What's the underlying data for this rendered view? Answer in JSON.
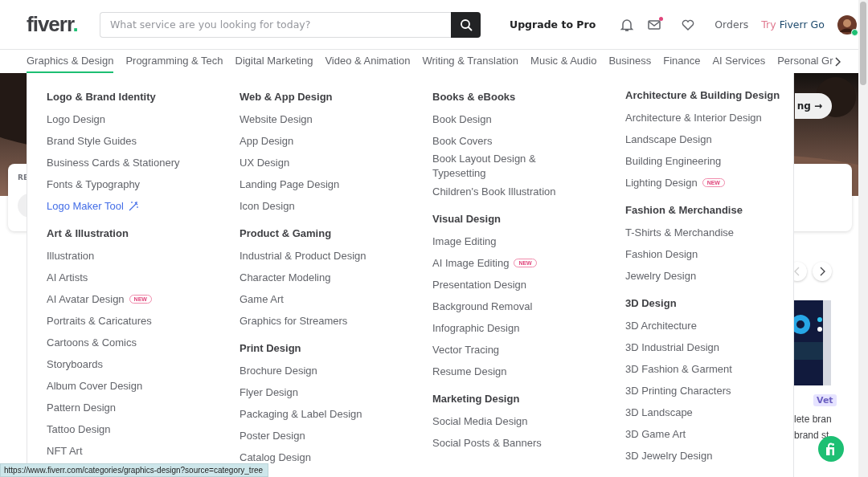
{
  "header": {
    "logo": "fiverr",
    "logo_dot": ".",
    "search": {
      "placeholder": "What service are you looking for today?"
    },
    "upgrade": "Upgrade to Pro",
    "messages_unread": true,
    "orders": "Orders",
    "try_prefix": "Try ",
    "try_brand": "Fiverr Go",
    "online": true
  },
  "categories": [
    {
      "label": "Graphics & Design",
      "selected": true
    },
    {
      "label": "Programming & Tech",
      "selected": false
    },
    {
      "label": "Digital Marketing",
      "selected": false
    },
    {
      "label": "Video & Animation",
      "selected": false
    },
    {
      "label": "Writing & Translation",
      "selected": false
    },
    {
      "label": "Music & Audio",
      "selected": false
    },
    {
      "label": "Business",
      "selected": false
    },
    {
      "label": "Finance",
      "selected": false
    },
    {
      "label": "AI Services",
      "selected": false
    },
    {
      "label": "Personal Gr",
      "selected": false
    }
  ],
  "background": {
    "card_label": "RE",
    "hero_button": "ng →",
    "tag": "Vet",
    "gig_lines": [
      "lete bran",
      "brand st"
    ]
  },
  "menu": {
    "columns": [
      [
        {
          "title": "Logo & Brand Identity",
          "items": [
            {
              "label": "Logo Design",
              "kind": "plain"
            },
            {
              "label": "Brand Style Guides",
              "kind": "plain"
            },
            {
              "label": "Business Cards & Stationery",
              "kind": "plain"
            },
            {
              "label": "Fonts & Typography",
              "kind": "plain"
            },
            {
              "label": "Logo Maker Tool",
              "kind": "tool"
            }
          ]
        },
        {
          "title": "Art & Illustration",
          "items": [
            {
              "label": "Illustration",
              "kind": "plain"
            },
            {
              "label": "AI Artists",
              "kind": "plain"
            },
            {
              "label": "AI Avatar Design",
              "kind": "plain",
              "badge": "NEW"
            },
            {
              "label": "Portraits & Caricatures",
              "kind": "plain"
            },
            {
              "label": "Cartoons & Comics",
              "kind": "plain"
            },
            {
              "label": "Storyboards",
              "kind": "plain"
            },
            {
              "label": "Album Cover Design",
              "kind": "plain"
            },
            {
              "label": "Pattern Design",
              "kind": "plain"
            },
            {
              "label": "Tattoo Design",
              "kind": "plain"
            },
            {
              "label": "NFT Art",
              "kind": "plain"
            }
          ]
        }
      ],
      [
        {
          "title": "Web & App Design",
          "items": [
            {
              "label": "Website Design",
              "kind": "plain"
            },
            {
              "label": "App Design",
              "kind": "plain"
            },
            {
              "label": "UX Design",
              "kind": "plain"
            },
            {
              "label": "Landing Page Design",
              "kind": "plain"
            },
            {
              "label": "Icon Design",
              "kind": "plain"
            }
          ]
        },
        {
          "title": "Product & Gaming",
          "items": [
            {
              "label": "Industrial & Product Design",
              "kind": "plain"
            },
            {
              "label": "Character Modeling",
              "kind": "plain"
            },
            {
              "label": "Game Art",
              "kind": "plain"
            },
            {
              "label": "Graphics for Streamers",
              "kind": "plain"
            }
          ]
        },
        {
          "title": "Print Design",
          "items": [
            {
              "label": "Brochure Design",
              "kind": "plain"
            },
            {
              "label": "Flyer Design",
              "kind": "plain"
            },
            {
              "label": "Packaging & Label Design",
              "kind": "plain"
            },
            {
              "label": "Poster Design",
              "kind": "plain"
            },
            {
              "label": "Catalog Design",
              "kind": "plain"
            }
          ]
        }
      ],
      [
        {
          "title": "Books & eBooks",
          "items": [
            {
              "label": "Book Design",
              "kind": "plain"
            },
            {
              "label": "Book Covers",
              "kind": "plain"
            },
            {
              "label": "Book Layout Design & Typesetting",
              "kind": "plain"
            },
            {
              "label": "Children's Book Illustration",
              "kind": "plain"
            }
          ]
        },
        {
          "title": "Visual Design",
          "items": [
            {
              "label": "Image Editing",
              "kind": "plain"
            },
            {
              "label": "AI Image Editing",
              "kind": "plain",
              "badge": "NEW"
            },
            {
              "label": "Presentation Design",
              "kind": "plain"
            },
            {
              "label": "Background Removal",
              "kind": "plain"
            },
            {
              "label": "Infographic Design",
              "kind": "plain"
            },
            {
              "label": "Vector Tracing",
              "kind": "plain"
            },
            {
              "label": "Resume Design",
              "kind": "plain"
            }
          ]
        },
        {
          "title": "Marketing Design",
          "items": [
            {
              "label": "Social Media Design",
              "kind": "plain"
            },
            {
              "label": "Social Posts & Banners",
              "kind": "plain"
            }
          ]
        }
      ],
      [
        {
          "title": "Architecture & Building Design",
          "items": [
            {
              "label": "Architecture & Interior Design",
              "kind": "plain"
            },
            {
              "label": "Landscape Design",
              "kind": "plain"
            },
            {
              "label": "Building Engineering",
              "kind": "plain"
            },
            {
              "label": "Lighting Design",
              "kind": "plain",
              "badge": "NEW"
            }
          ]
        },
        {
          "title": "Fashion & Merchandise",
          "items": [
            {
              "label": "T-Shirts & Merchandise",
              "kind": "plain"
            },
            {
              "label": "Fashion Design",
              "kind": "plain"
            },
            {
              "label": "Jewelry Design",
              "kind": "plain"
            }
          ]
        },
        {
          "title": "3D Design",
          "items": [
            {
              "label": "3D Architecture",
              "kind": "plain"
            },
            {
              "label": "3D Industrial Design",
              "kind": "plain"
            },
            {
              "label": "3D Fashion & Garment",
              "kind": "plain"
            },
            {
              "label": "3D Printing Characters",
              "kind": "plain"
            },
            {
              "label": "3D Landscape",
              "kind": "plain"
            },
            {
              "label": "3D Game Art",
              "kind": "plain"
            },
            {
              "label": "3D Jewelry Design",
              "kind": "plain"
            }
          ]
        }
      ]
    ]
  },
  "status_url": "https://www.fiverr.com/categories/graphics-design?source=category_tree"
}
